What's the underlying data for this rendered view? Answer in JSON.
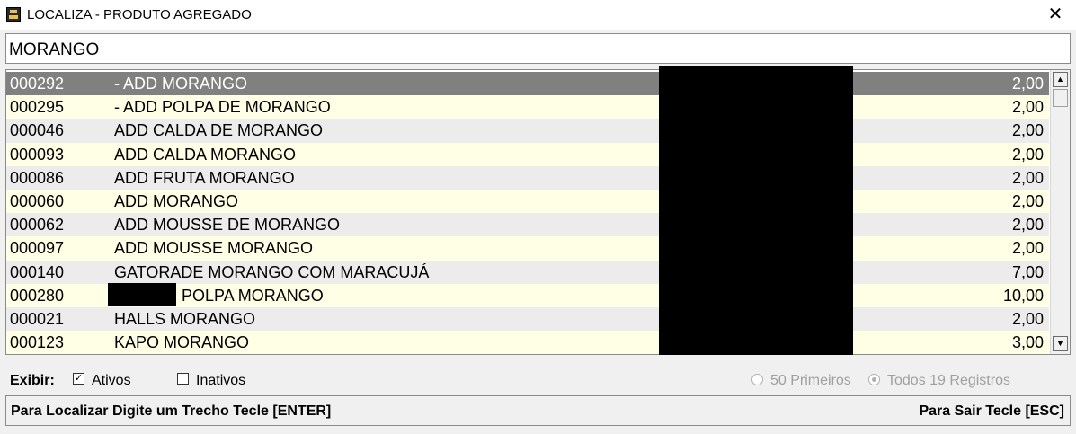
{
  "window": {
    "title": "LOCALIZA - PRODUTO AGREGADO",
    "app_icon": "register-icon",
    "close_glyph": "✕"
  },
  "search": {
    "value": "MORANGO"
  },
  "table": {
    "rows": [
      {
        "code": "000292",
        "name": "- ADD MORANGO",
        "price": "2,00",
        "selected": true
      },
      {
        "code": "000295",
        "name": "- ADD POLPA DE MORANGO",
        "price": "2,00"
      },
      {
        "code": "000046",
        "name": "ADD CALDA DE MORANGO",
        "price": "2,00"
      },
      {
        "code": "000093",
        "name": "ADD CALDA MORANGO",
        "price": "2,00"
      },
      {
        "code": "000086",
        "name": "ADD FRUTA MORANGO",
        "price": "2,00"
      },
      {
        "code": "000060",
        "name": "ADD MORANGO",
        "price": "2,00"
      },
      {
        "code": "000062",
        "name": "ADD MOUSSE DE MORANGO",
        "price": "2,00"
      },
      {
        "code": "000097",
        "name": "ADD MOUSSE MORANGO",
        "price": "2,00"
      },
      {
        "code": "000140",
        "name": "GATORADE MORANGO COM MARACUJÁ",
        "price": "7,00"
      },
      {
        "code": "000280",
        "name": "POLPA MORANGO",
        "price": "10,00",
        "name_redacted_prefix": true
      },
      {
        "code": "000021",
        "name": "HALLS MORANGO",
        "price": "2,00"
      },
      {
        "code": "000123",
        "name": "KAPO MORANGO",
        "price": "3,00"
      }
    ],
    "scroll_up_glyph": "▲",
    "scroll_down_glyph": "▼"
  },
  "filters": {
    "label": "Exibir:",
    "ativos": {
      "label": "Ativos",
      "checked": true
    },
    "inativos": {
      "label": "Inativos",
      "checked": false
    },
    "primeiros": {
      "label": "50 Primeiros",
      "selected": false,
      "enabled": false
    },
    "todos": {
      "label": "Todos 19 Registros",
      "selected": true,
      "enabled": false
    },
    "check_glyph": "✓"
  },
  "status": {
    "left": "Para Localizar Digite um Trecho Tecle [ENTER]",
    "right": "Para Sair Tecle [ESC]"
  },
  "colors": {
    "row_odd": "#ffffe6",
    "row_even": "#ececec",
    "row_selected": "#808080"
  }
}
